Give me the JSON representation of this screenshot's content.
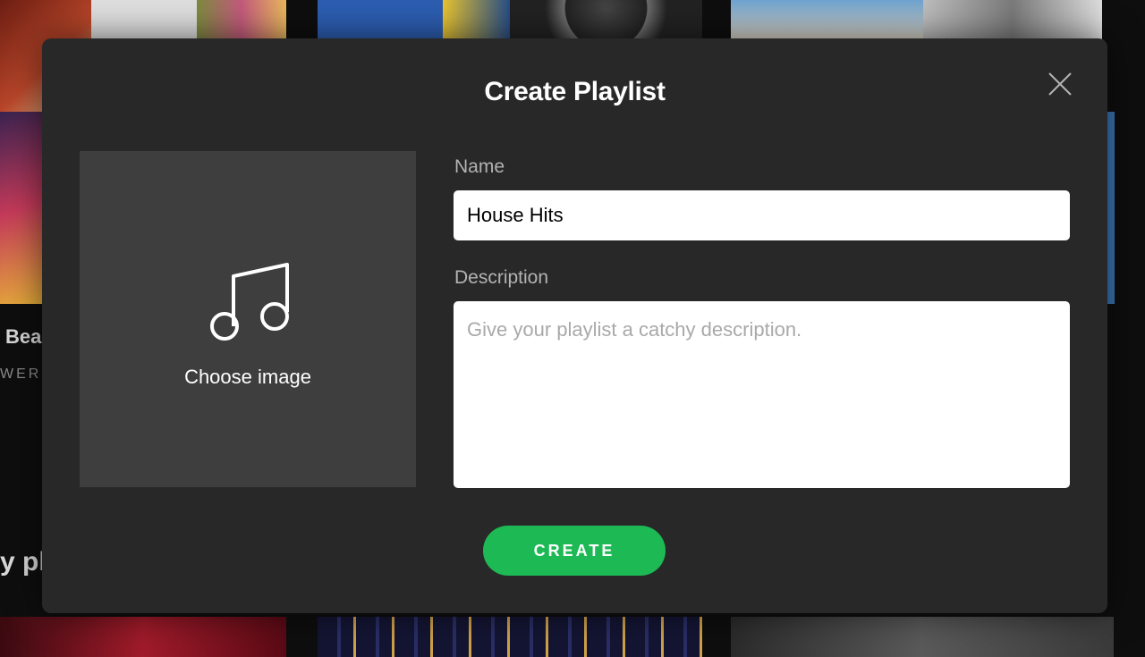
{
  "background": {
    "partial_text_1": "Bea",
    "partial_text_2": "WERS",
    "partial_text_3": "y pl"
  },
  "modal": {
    "title": "Create Playlist",
    "close_icon": "close-icon",
    "image_picker": {
      "icon": "music-note-icon",
      "label": "Choose image"
    },
    "name_field": {
      "label": "Name",
      "value": "House Hits"
    },
    "description_field": {
      "label": "Description",
      "placeholder": "Give your playlist a catchy description.",
      "value": ""
    },
    "create_button_label": "CREATE"
  },
  "colors": {
    "modal_bg": "#282828",
    "accent": "#1db954",
    "image_picker_bg": "#3e3e3e"
  }
}
